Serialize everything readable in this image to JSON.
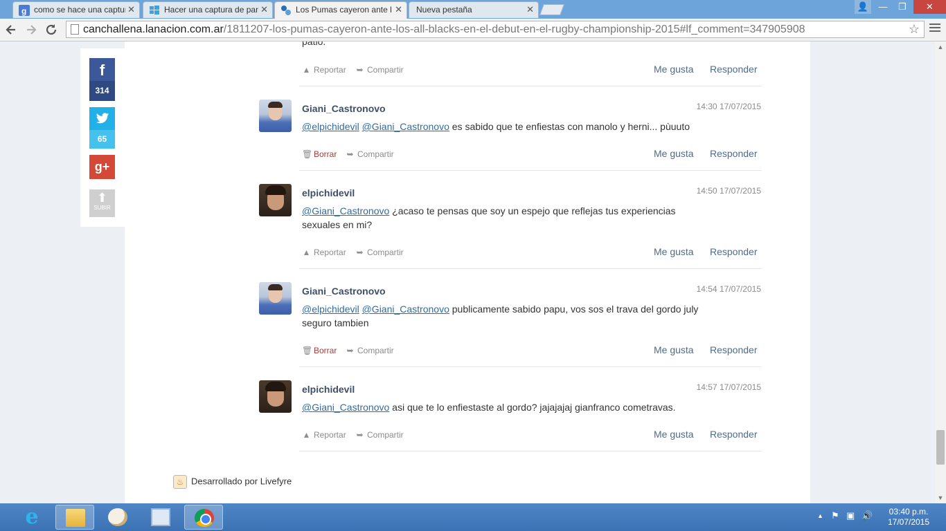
{
  "tabs": [
    {
      "label": "como se hace una captura",
      "icon": "google-icon"
    },
    {
      "label": "Hacer una captura de pan",
      "icon": "windows-icon"
    },
    {
      "label": "Los Pumas cayeron ante l",
      "icon": "lanacion-icon"
    },
    {
      "label": "Nueva pestaña",
      "icon": ""
    }
  ],
  "tab_close_glyph": "✕",
  "window": {
    "minimize": "—",
    "maximize": "❐",
    "close": "✕",
    "profile": "👤"
  },
  "omnibox": {
    "host": "canchallena.lanacion.com.ar",
    "path": "/1811207-los-pumas-cayeron-ante-los-all-blacks-en-el-debut-en-el-rugby-championship-2015#lf_comment=347905908"
  },
  "social": {
    "facebook_count": "314",
    "twitter_count": "65",
    "google_plus": "g+",
    "subir": "SUBIR"
  },
  "previous_tail": "patio.",
  "actions": {
    "reportar": "Reportar",
    "borrar": "Borrar",
    "compartir": "Compartir",
    "me_gusta": "Me gusta",
    "responder": "Responder"
  },
  "comments": [
    {
      "author": "Giani_Castronovo",
      "time": "14:30 17/07/2015",
      "mentions": [
        "@elpichidevil",
        "@Giani_Castronovo"
      ],
      "text": " es sabido que te enfiestas con manolo y herni... pùuuto"
    },
    {
      "author": "elpichidevil",
      "time": "14:50 17/07/2015",
      "mentions": [
        "@Giani_Castronovo"
      ],
      "text": " ¿acaso te pensas que soy un espejo que reflejas tus experiencias sexuales en mi?"
    },
    {
      "author": "Giani_Castronovo",
      "time": "14:54 17/07/2015",
      "mentions": [
        "@elpichidevil",
        "@Giani_Castronovo"
      ],
      "text": " publicamente sabido papu, vos sos el trava del gordo july seguro tambien"
    },
    {
      "author": "elpichidevil",
      "time": "14:57 17/07/2015",
      "mentions": [
        "@Giani_Castronovo"
      ],
      "text": "  asi que te lo enfiestaste al gordo? jajajajaj gianfranco cometravas."
    }
  ],
  "livefyre": "Desarrollado por Livefyre",
  "taskbar": {
    "clock_time": "03:40 p.m.",
    "clock_date": "17/07/2015",
    "tray": {
      "chevron": "▲",
      "flag": "⚑",
      "network": "▣",
      "volume": "🔊"
    }
  },
  "scroll": {
    "up": "▲",
    "down": "▼"
  },
  "colors": {
    "link": "#2e6da4",
    "author": "#3d4f66",
    "action_link": "#4f6b8a",
    "facebook": "#3b5998",
    "twitter": "#21b0e7",
    "google_plus": "#d34836"
  }
}
